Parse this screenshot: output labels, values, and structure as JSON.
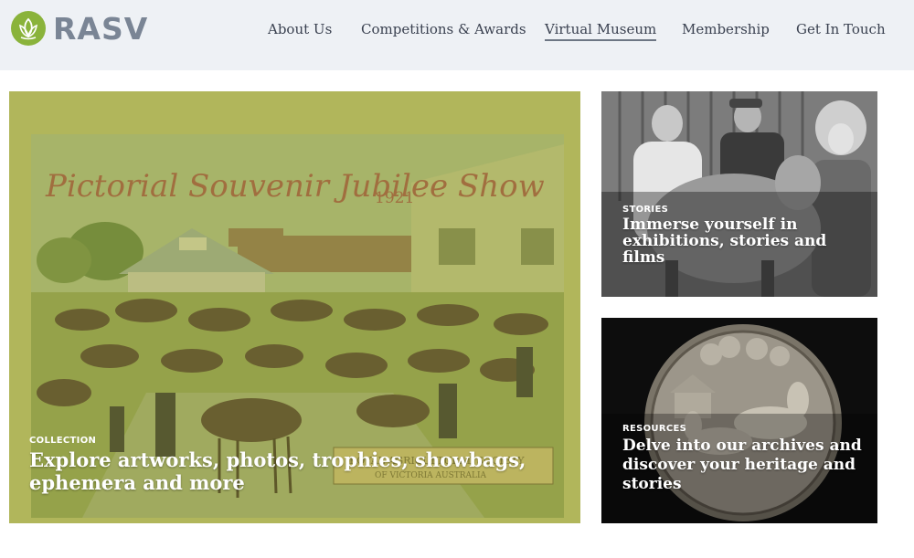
{
  "brand": {
    "name": "RASV",
    "accent": "#8ab33b",
    "text_color": "#7a8595"
  },
  "nav": {
    "items": [
      {
        "label": "About Us"
      },
      {
        "label": "Competitions & Awards"
      },
      {
        "label": "Virtual Museum",
        "active": true
      },
      {
        "label": "Membership"
      },
      {
        "label": "Get In Touch"
      }
    ]
  },
  "cards": {
    "collection": {
      "category": "COLLECTION",
      "title": "Explore artworks, photos, trophies, showbags, ephemera and more",
      "image_text": {
        "poster_title": "Pictorial Souvenir Jubilee Show",
        "poster_year": "1921",
        "banner": "ROYAL AGRICULTURAL SOCIETY",
        "banner_sub": "OF VICTORIA  AUSTRALIA"
      }
    },
    "stories": {
      "category": "STORIES",
      "title": "Immerse yourself in exhibitions, stories and films"
    },
    "resources": {
      "category": "RESOURCES",
      "title": "Delve into our archives and discover your heritage and stories"
    }
  },
  "colors": {
    "header_bg": "#eef1f5",
    "overlay_green": "#a4b24a",
    "card_dark": "#111111"
  }
}
